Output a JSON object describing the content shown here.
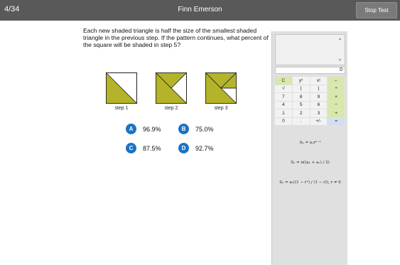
{
  "header": {
    "counter": "4/34",
    "student_name": "Finn Emerson",
    "stop_label": "Stop Test"
  },
  "question": {
    "text": "Each new shaded triangle is half the size of the smallest shaded triangle in the previous step. If the pattern continues, what percent of the square will be shaded in step 5?"
  },
  "steps": [
    {
      "label": "step 1"
    },
    {
      "label": "step 2"
    },
    {
      "label": "step 3"
    }
  ],
  "colors": {
    "shade": "#b5b32a",
    "header_bg": "#595959",
    "choice_badge": "#1a73c4",
    "key_green": "#d8e8a8"
  },
  "choices": [
    {
      "letter": "A",
      "value": "96.9%"
    },
    {
      "letter": "B",
      "value": "75.0%"
    },
    {
      "letter": "C",
      "value": "87.5%"
    },
    {
      "letter": "D",
      "value": "92.7%"
    }
  ],
  "calculator": {
    "display": "0",
    "keys": [
      {
        "label": "C",
        "style": "green"
      },
      {
        "label": "yˣ",
        "style": "gray"
      },
      {
        "label": "x!",
        "style": "gray"
      },
      {
        "label": "←",
        "style": "green"
      },
      {
        "label": "√",
        "style": "gray"
      },
      {
        "label": "(",
        "style": "gray"
      },
      {
        "label": ")",
        "style": "gray"
      },
      {
        "label": "÷",
        "style": "green"
      },
      {
        "label": "7",
        "style": "gray"
      },
      {
        "label": "8",
        "style": "gray"
      },
      {
        "label": "9",
        "style": "gray"
      },
      {
        "label": "×",
        "style": "green"
      },
      {
        "label": "4",
        "style": "gray"
      },
      {
        "label": "5",
        "style": "gray"
      },
      {
        "label": "6",
        "style": "gray"
      },
      {
        "label": "−",
        "style": "green"
      },
      {
        "label": "1",
        "style": "gray"
      },
      {
        "label": "2",
        "style": "gray"
      },
      {
        "label": "3",
        "style": "gray"
      },
      {
        "label": "+",
        "style": "green"
      },
      {
        "label": "0",
        "style": "gray"
      },
      {
        "label": ".",
        "style": "gray"
      },
      {
        "label": "+/-",
        "style": "gray"
      },
      {
        "label": "=",
        "style": "blue"
      }
    ],
    "formulas": [
      "Aₙ = a₁rⁿ⁻¹",
      "Sₙ = n((a₁ + aₙ) / 2)",
      "Sₙ = a₁((1 − rⁿ) / (1 − r)), r ≠ 0"
    ]
  }
}
